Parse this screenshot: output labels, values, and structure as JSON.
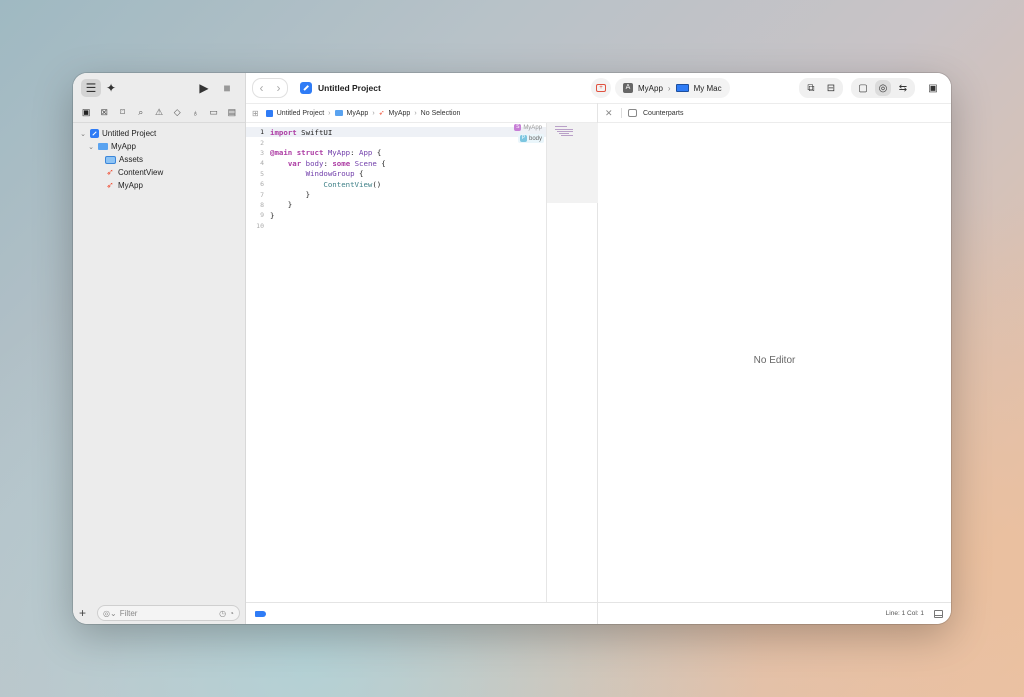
{
  "window": {
    "title": "Untitled Project"
  },
  "toolbar": {
    "scheme": "MyApp",
    "destination": "My Mac"
  },
  "navigator": {
    "tree": [
      {
        "label": "Untitled Project",
        "level": 0,
        "icon": "project-icon",
        "expanded": true
      },
      {
        "label": "MyApp",
        "level": 1,
        "icon": "folder-icon",
        "expanded": true
      },
      {
        "label": "Assets",
        "level": 2,
        "icon": "assets-icon"
      },
      {
        "label": "ContentView",
        "level": 2,
        "icon": "swift-file-icon"
      },
      {
        "label": "MyApp",
        "level": 2,
        "icon": "swift-file-icon"
      }
    ],
    "filter_placeholder": "Filter"
  },
  "jumpbar": {
    "items": [
      "Untitled Project",
      "MyApp",
      "MyApp",
      "No Selection"
    ]
  },
  "editor": {
    "lines": [
      {
        "n": "1",
        "tokens": [
          {
            "t": "import",
            "c": "kw"
          },
          {
            "t": " SwiftUI",
            "c": "plain"
          }
        ]
      },
      {
        "n": "2",
        "tokens": []
      },
      {
        "n": "3",
        "tokens": [
          {
            "t": "@main",
            "c": "kw"
          },
          {
            "t": " ",
            "c": "plain"
          },
          {
            "t": "struct",
            "c": "kw"
          },
          {
            "t": " ",
            "c": "plain"
          },
          {
            "t": "MyApp",
            "c": "type"
          },
          {
            "t": ": ",
            "c": "plain"
          },
          {
            "t": "App",
            "c": "type"
          },
          {
            "t": " {",
            "c": "plain"
          }
        ]
      },
      {
        "n": "4",
        "tokens": [
          {
            "t": "    ",
            "c": "plain"
          },
          {
            "t": "var",
            "c": "kw"
          },
          {
            "t": " ",
            "c": "plain"
          },
          {
            "t": "body",
            "c": "type"
          },
          {
            "t": ": ",
            "c": "plain"
          },
          {
            "t": "some",
            "c": "kw"
          },
          {
            "t": " ",
            "c": "plain"
          },
          {
            "t": "Scene",
            "c": "type"
          },
          {
            "t": " {",
            "c": "plain"
          }
        ]
      },
      {
        "n": "5",
        "tokens": [
          {
            "t": "        ",
            "c": "plain"
          },
          {
            "t": "WindowGroup",
            "c": "type"
          },
          {
            "t": " {",
            "c": "plain"
          }
        ]
      },
      {
        "n": "6",
        "tokens": [
          {
            "t": "            ",
            "c": "plain"
          },
          {
            "t": "ContentView",
            "c": "cls"
          },
          {
            "t": "()",
            "c": "plain"
          }
        ]
      },
      {
        "n": "7",
        "tokens": [
          {
            "t": "        }",
            "c": "plain"
          }
        ]
      },
      {
        "n": "8",
        "tokens": [
          {
            "t": "    }",
            "c": "plain"
          }
        ]
      },
      {
        "n": "9",
        "tokens": [
          {
            "t": "}",
            "c": "plain"
          }
        ]
      },
      {
        "n": "10",
        "tokens": []
      }
    ],
    "badges": [
      {
        "letter": "S",
        "label": "MyApp"
      },
      {
        "letter": "P",
        "label": "body"
      }
    ]
  },
  "right_pane": {
    "counterparts_label": "Counterparts",
    "empty_message": "No Editor"
  },
  "status": {
    "line": "Line: 1",
    "col": "Col: 1"
  },
  "colors": {
    "accent": "#2f7cf6",
    "swift": "#f05138",
    "keyword": "#ad3da4"
  }
}
